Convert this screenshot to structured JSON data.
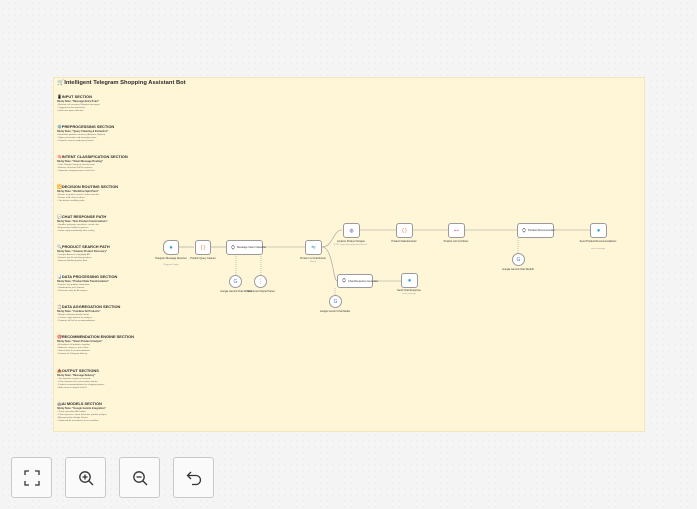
{
  "sticky": {
    "title": "🛒Intelligent Telegram Shopping Assistant Bot",
    "sections": [
      {
        "title": "📱INPUT SECTION",
        "node": "Sticky Note: \"Message Entry Point\"",
        "lines": [
          "• Receives all incoming Telegram messages",
          "• Triggered on bot interaction",
          "• Initial user input collection"
        ]
      },
      {
        "title": "⚙️PREPROCESSING SECTION",
        "node": "Sticky Note: \"Query Cleaning & Extraction\"",
        "lines": [
          "• Normalize platform variations (Amazon, Flipkart)",
          "• Strips punctuation and formatting noise",
          "• Prepares search-ready query format"
        ]
      },
      {
        "title": "🧠INTENT CLASSIFICATION SECTION",
        "node": "Sticky Note: \"Smart Message Routing\"",
        "lines": [
          "• Uses Google Prompt to classify intent",
          "• Returns structured JSON response",
          "• Separates shopping from casual chat"
        ]
      },
      {
        "title": "🔀DECISION ROUTING SECTION",
        "node": "Sticky Note: \"Workflow Split Point\"",
        "lines": [
          "• Routes to product search if intent matches",
          "• Routes to AI chat for others",
          "• Two distinct workflow paths"
        ]
      },
      {
        "title": "💬CHAT RESPONSE PATH",
        "node": "Sticky Note: \"Non-Product Conversations\"",
        "lines": [
          "• Handles greetings, questions, casual chat",
          "• AI generates helpful responses",
          "• Sends reply immediately after routing"
        ]
      },
      {
        "title": "🔍PRODUCT SEARCH PATH",
        "node": "Sticky Note: \"Amazon Product Discovery\"",
        "lines": [
          "• Scrapes Amazon using Apify API",
          "• Extracts top 10 matching products",
          "• Returns detailed product data"
        ]
      },
      {
        "title": "📊DATA PROCESSING SECTION",
        "node": "Sticky Note: \"Product Data Transformation\"",
        "lines": [
          "• Extracts key product information",
          "• Standardizes price formats",
          "• Structures data for AI analysis"
        ]
      },
      {
        "title": "📋DATA AGGREGATION SECTION",
        "node": "Sticky Note: \"Combine All Products\"",
        "lines": [
          "• Merges individual product items",
          "• Creates single dataset for analysis",
          "• Prepares full list for recommendations"
        ]
      },
      {
        "title": "🎯RECOMMENDATION ENGINE SECTION",
        "node": "Sticky Note: \"Smart Product Analysis\"",
        "lines": [
          "• AI analyzes all products together",
          "• Balances ratings vs price value",
          "• Selects best 3 recommendations",
          "• Formats for Telegram delivery"
        ]
      },
      {
        "title": "📤OUTPUT SECTIONS",
        "node": "Sticky Note: \"Message Delivery\"",
        "lines": [
          "• Two separate response channels",
          "• Chat responses for conversation queries",
          "• Product recommendations for shopping queries",
          "• Both return to original chat ID"
        ]
      },
      {
        "title": "🤖AI MODELS SECTION",
        "node": "Sticky Note: \"Google Gemini Integration\"",
        "lines": [
          "• Three specialized AI models",
          "• Chat responses, intent detection, product analysis",
          "• All powered by Google Gemini",
          "• Optimized for ecommerce focus workflow"
        ]
      }
    ]
  },
  "nodes": {
    "telegram_trigger": {
      "label": "Telegram Message Receiver",
      "sub": "Telegram Trigger",
      "icon": "telegram-icon"
    },
    "product_query_cleaner": {
      "label": "Product Query Cleaner",
      "icon": "code-braces-icon"
    },
    "message_intent_classifier": {
      "label": "Message Intent Classifier",
      "icon": "robot-icon"
    },
    "gemini_chat_model_1": {
      "label": "Google Gemini Chat Model1",
      "icon": "gemini-icon"
    },
    "structured_output_parser": {
      "label": "Structured Output Parser",
      "icon": "parser-icon"
    },
    "product_vs_chat_router": {
      "label": "Product vs Chat Router",
      "sub": "Switch",
      "icon": "switch-icon"
    },
    "amazon_product_scraper": {
      "label": "Amazon Product Scraper",
      "sub": "POST: https://api.apify.com/v2/acts/...",
      "icon": "globe-icon"
    },
    "product_data_extractor": {
      "label": "Product Data Extractor",
      "icon": "code-braces-icon"
    },
    "product_list_combiner": {
      "label": "Product List Combiner",
      "icon": "aggregate-icon"
    },
    "product_recommender": {
      "label": "Product Recommender",
      "icon": "robot-icon"
    },
    "gemini_chat_model_2": {
      "label": "Google Gemini Chat Model2",
      "icon": "gemini-icon"
    },
    "send_recommendations": {
      "label": "Send Product Recommendations",
      "sub": "send: message",
      "icon": "telegram-icon"
    },
    "chat_response_generator": {
      "label": "Chat Response Generator",
      "icon": "robot-icon"
    },
    "gemini_chat_model": {
      "label": "Google Gemini Chat Model",
      "icon": "gemini-icon"
    },
    "send_chat_response": {
      "label": "Send Chat Response",
      "sub": "send: message",
      "icon": "telegram-icon"
    }
  },
  "controls": {
    "fit_view": "fit-view-icon",
    "zoom_in": "zoom-in-icon",
    "zoom_out": "zoom-out-icon",
    "undo": "undo-icon"
  }
}
